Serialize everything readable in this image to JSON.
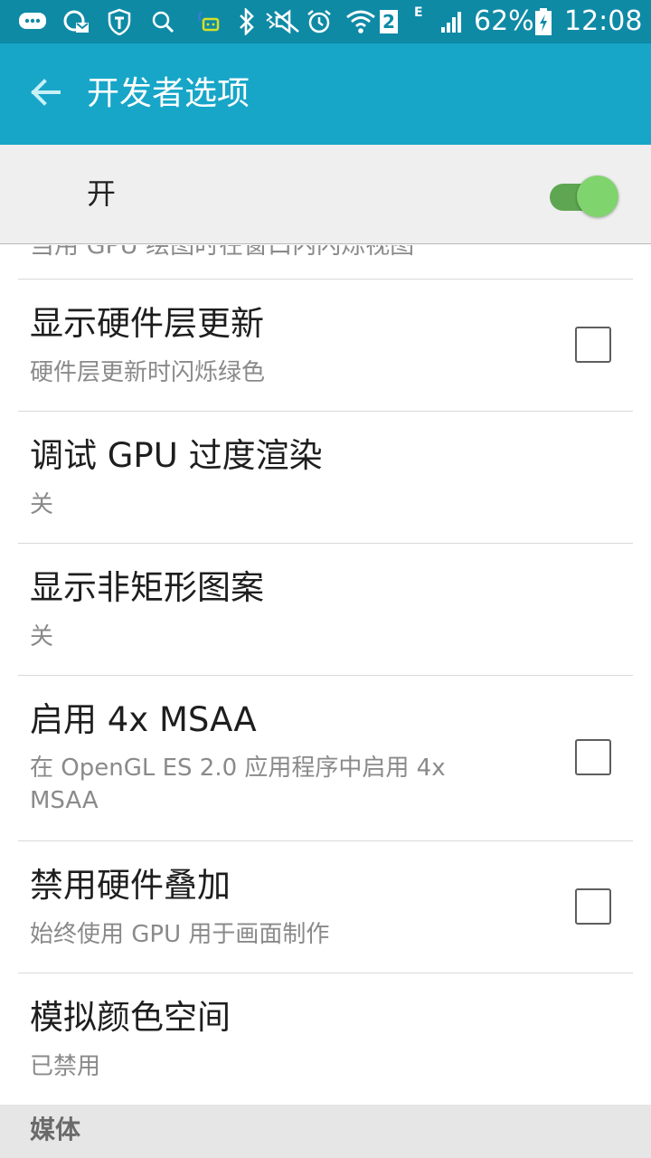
{
  "status_bar": {
    "icons": [
      "chat-bubble-icon",
      "vpn-key-icon",
      "shield-icon",
      "search-icon",
      "message-icon",
      "bluetooth-icon",
      "mute-icon",
      "alarm-icon",
      "wifi-icon",
      "sim-2-badge",
      "network-e-icon",
      "signal-icon",
      "battery-charging-icon"
    ],
    "sim_label": "2",
    "network_label": "E",
    "battery_percent": "62%",
    "time": "12:08"
  },
  "action_bar": {
    "back_icon": "arrow-back-icon",
    "title": "开发者选项"
  },
  "master_switch": {
    "label": "开",
    "checked": true
  },
  "partial_item": {
    "summary": "当用 GPU 绘图时在窗口内闪烁视图"
  },
  "items": [
    {
      "title": "显示硬件层更新",
      "summary": "硬件层更新时闪烁绿色",
      "has_checkbox": true,
      "checked": false
    },
    {
      "title": "调试 GPU 过度渲染",
      "summary": "关",
      "has_checkbox": false
    },
    {
      "title": "显示非矩形图案",
      "summary": "关",
      "has_checkbox": false
    },
    {
      "title": "启用 4x MSAA",
      "summary": "在 OpenGL ES 2.0 应用程序中启用 4x MSAA",
      "has_checkbox": true,
      "checked": false
    },
    {
      "title": "禁用硬件叠加",
      "summary": "始终使用 GPU 用于画面制作",
      "has_checkbox": true,
      "checked": false
    },
    {
      "title": "模拟颜色空间",
      "summary": "已禁用",
      "has_checkbox": false
    }
  ],
  "category": {
    "label": "媒体"
  },
  "colors": {
    "status_bar": "#0e8aa5",
    "action_bar": "#17a6c8",
    "toggle_on_track": "#5fa653",
    "toggle_on_thumb": "#80d46e"
  }
}
